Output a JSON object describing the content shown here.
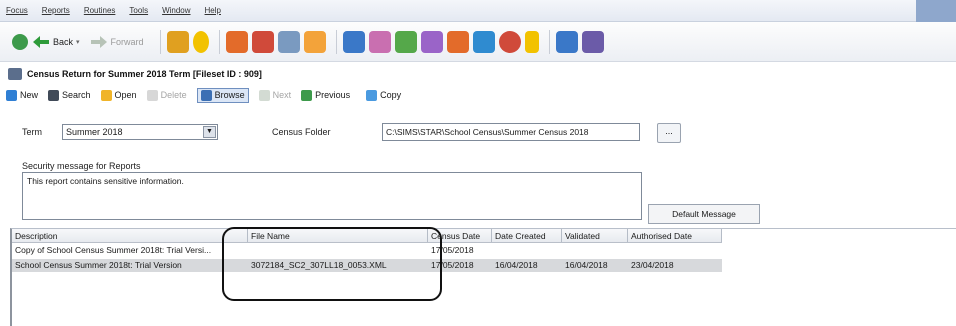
{
  "menu": [
    "Focus",
    "Reports",
    "Routines",
    "Tools",
    "Window",
    "Help"
  ],
  "toolbar": {
    "back": "Back",
    "forward": "Forward",
    "icon_colors": [
      "#e0a020",
      "#f2c200",
      "#e36b2a",
      "#3a78c8",
      "#55a84a",
      "#d04a3a",
      "#7a9ac0",
      "#f3a33a",
      "#c96fb0",
      "#9a64c8",
      "#2f8bd0",
      "#6b5ba8"
    ]
  },
  "window": {
    "title": "Census Return for Summer 2018 Term [Fileset ID : 909]"
  },
  "actions": {
    "new": "New",
    "search": "Search",
    "open": "Open",
    "delete": "Delete",
    "browse": "Browse",
    "next": "Next",
    "previous": "Previous",
    "copy": "Copy"
  },
  "form": {
    "term_label": "Term",
    "term_value": "Summer 2018",
    "folder_label": "Census Folder",
    "folder_value": "C:\\SIMS\\STAR\\School Census\\Summer Census 2018",
    "browse_button": "...",
    "security_label": "Security message for Reports",
    "security_value": "This report contains sensitive information.",
    "default_message_button": "Default Message"
  },
  "grid": {
    "headers": [
      "Description",
      "File Name",
      "Census Date",
      "Date Created",
      "Validated",
      "Authorised Date"
    ],
    "rows": [
      [
        "Copy of School Census Summer 2018t: Trial Versi...",
        "",
        "17/05/2018",
        "",
        "",
        ""
      ],
      [
        "School Census Summer 2018t: Trial Version",
        "3072184_SC2_307LL18_0053.XML",
        "17/05/2018",
        "16/04/2018",
        "16/04/2018",
        "23/04/2018"
      ]
    ]
  }
}
